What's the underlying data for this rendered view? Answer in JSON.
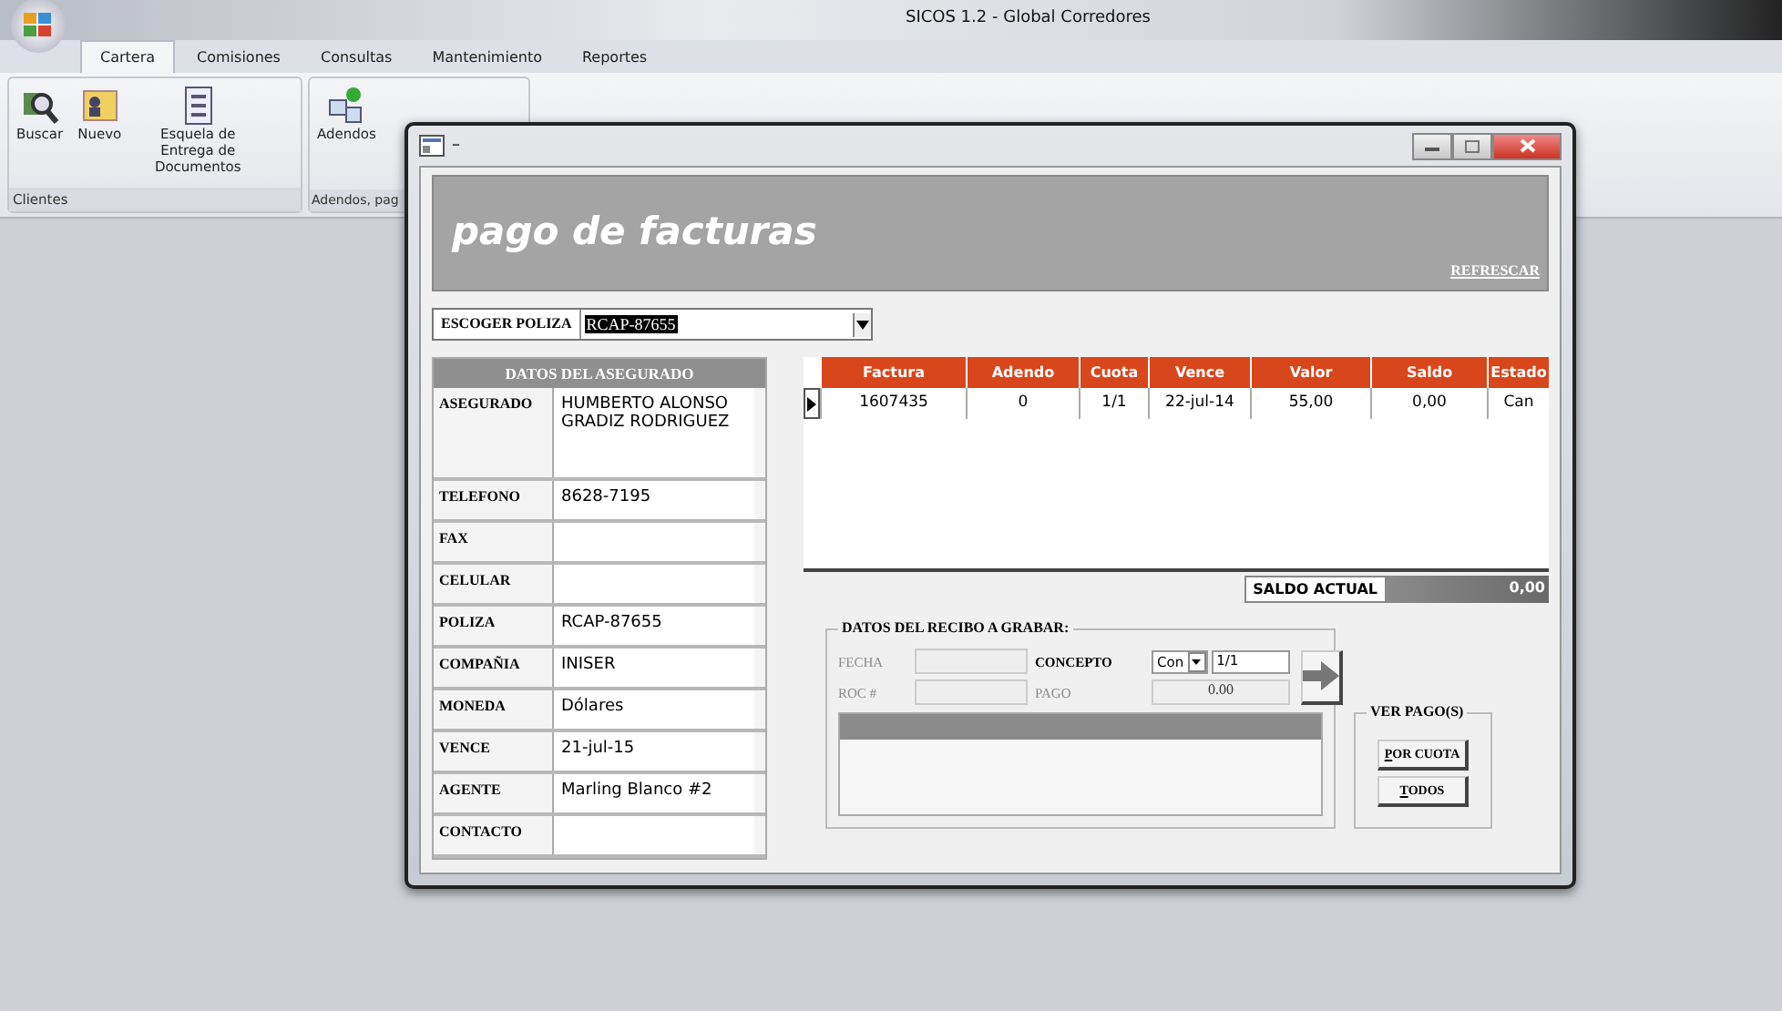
{
  "window": {
    "title": "SICOS 1.2 - Global Corredores"
  },
  "ribbon_tabs": [
    {
      "label": "Cartera",
      "selected": true
    },
    {
      "label": "Comisiones",
      "selected": false
    },
    {
      "label": "Consultas",
      "selected": false
    },
    {
      "label": "Mantenimiento",
      "selected": false
    },
    {
      "label": "Reportes",
      "selected": false
    }
  ],
  "ribbon_groups": [
    {
      "label": "Clientes",
      "buttons": [
        {
          "label": "Buscar",
          "kind": "search"
        },
        {
          "label": "Nuevo",
          "kind": "card"
        },
        {
          "label": "Esquela de Entrega de Documentos",
          "kind": "document"
        }
      ]
    },
    {
      "label": "Adendos, pag",
      "buttons": [
        {
          "label": "Adendos",
          "kind": "addendum"
        }
      ]
    }
  ],
  "dialog": {
    "title": "–",
    "heading": "pago de facturas",
    "refresh_link": "REFRESCAR",
    "policy_picker": {
      "label": "ESCOGER POLIZA",
      "value": "RCAP-87655"
    },
    "insured": {
      "title": "DATOS DEL ASEGURADO",
      "fields": [
        {
          "label": "ASEGURADO",
          "value": "HUMBERTO ALONSO GRADIZ RODRIGUEZ",
          "kind": "tall"
        },
        {
          "label": "TELEFONO",
          "value": "8628-7195",
          "kind": "line"
        },
        {
          "label": "FAX",
          "kind": "line"
        },
        {
          "label": "CELULAR",
          "kind": "line"
        },
        {
          "label": "POLIZA",
          "value": "RCAP-87655",
          "kind": "line"
        },
        {
          "label": "COMPAÑIA",
          "value": "INISER",
          "kind": "line"
        },
        {
          "label": "MONEDA",
          "value": "Dólares",
          "kind": "line"
        },
        {
          "label": "VENCE",
          "value": "21-jul-15",
          "kind": "line"
        },
        {
          "label": "AGENTE",
          "value": "Marling Blanco #2",
          "kind": "line"
        },
        {
          "label": "CONTACTO",
          "kind": "line"
        }
      ]
    },
    "invoices": {
      "columns": [
        "Factura",
        "Adendo",
        "Cuota",
        "Vence",
        "Valor",
        "Saldo",
        "Estado"
      ],
      "rows": [
        {
          "selected": true,
          "cells": [
            "1607435",
            "0",
            "1/1",
            "22-jul-14",
            "55,00",
            "0,00",
            "Can"
          ]
        }
      ]
    },
    "balance": {
      "label": "SALDO ACTUAL",
      "value": "0,00"
    },
    "receipt": {
      "title": "DATOS DEL RECIBO A GRABAR:",
      "date": {
        "label": "FECHA",
        "disabled": true
      },
      "roc": {
        "label": "ROC #",
        "disabled": true
      },
      "concept": {
        "label": "CONCEPTO",
        "value": "Con",
        "quota": "1/1"
      },
      "payment": {
        "label": "PAGO",
        "value": "0.00",
        "disabled": true
      }
    },
    "payments": {
      "title": "VER PAGO(S)",
      "buttons": [
        "POR CUOTA",
        "TODOS"
      ]
    }
  }
}
